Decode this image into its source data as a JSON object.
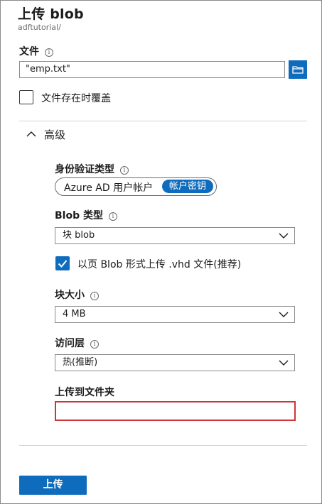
{
  "header": {
    "title": "上传 blob",
    "subtitle": "adftutorial/"
  },
  "file": {
    "label": "文件",
    "value": "\"emp.txt\""
  },
  "overwrite": {
    "label": "文件存在时覆盖",
    "checked": false
  },
  "advanced": {
    "label": "高级",
    "expanded": true,
    "auth_type": {
      "label": "身份验证类型",
      "options": [
        "Azure AD 用户帐户",
        "帐户密钥"
      ],
      "selected": "帐户密钥"
    },
    "blob_type": {
      "label": "Blob 类型",
      "value": "块 blob"
    },
    "vhd_page_blob": {
      "label": "以页 Blob 形式上传 .vhd 文件(推荐)",
      "checked": true
    },
    "block_size": {
      "label": "块大小",
      "value": "4 MB"
    },
    "access_tier": {
      "label": "访问层",
      "value": "热(推断)"
    },
    "upload_folder": {
      "label": "上传到文件夹",
      "value": ""
    }
  },
  "actions": {
    "upload_label": "上传"
  },
  "colors": {
    "accent": "#0f6cbd",
    "error_border": "#d13438"
  }
}
